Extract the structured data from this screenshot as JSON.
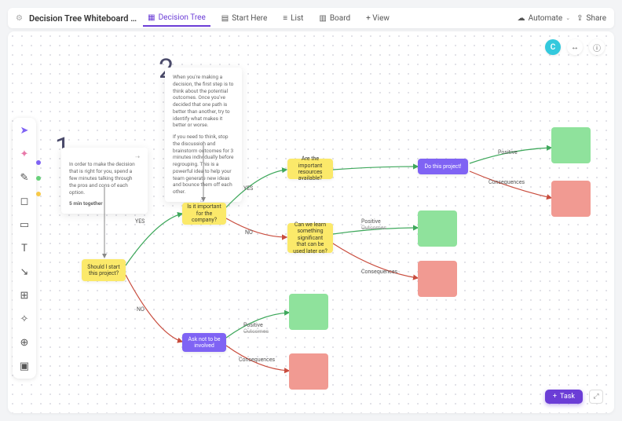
{
  "header": {
    "title": "Decision Tree Whiteboard …",
    "tabs": [
      {
        "label": "Decision Tree",
        "active": true
      },
      {
        "label": "Start Here"
      },
      {
        "label": "List"
      },
      {
        "label": "Board"
      },
      {
        "label": "+ View"
      }
    ],
    "automate": "Automate",
    "share": "Share",
    "avatar": "C"
  },
  "palette": [
    "#7f63f4",
    "#68d17a",
    "#f7c948"
  ],
  "nums": {
    "one": "1",
    "two": "2"
  },
  "callout1": {
    "body": "In order to make the decision that is right for you, spend a few minutes talking through the pros and cons of each option.",
    "foot": "5 min together"
  },
  "callout2": {
    "p1": "When you're making a decision, the first step is to think about the potential outcomes. Once you've decided that one path is better than another, try to identify what makes it better or worse.",
    "p2": "If you need to think, stop the discussion and brainstorm outcomes for 3 minutes individually before regrouping. This is a powerful idea to help your team generate new ideas and bounce them off each other."
  },
  "nodes": {
    "start": "Should I start this project?",
    "company": "Is it important for the company?",
    "resources": "Are the important resources available?",
    "do": "Do this project!",
    "learn": "Can we learn something significant that can be used later on?",
    "ask": "Ask not to be involved"
  },
  "labels": {
    "yes": "YES",
    "no": "NO",
    "positive": "Positive",
    "outcomes": "Outcomes",
    "consequences": "Consequences"
  },
  "task_button": "Task"
}
